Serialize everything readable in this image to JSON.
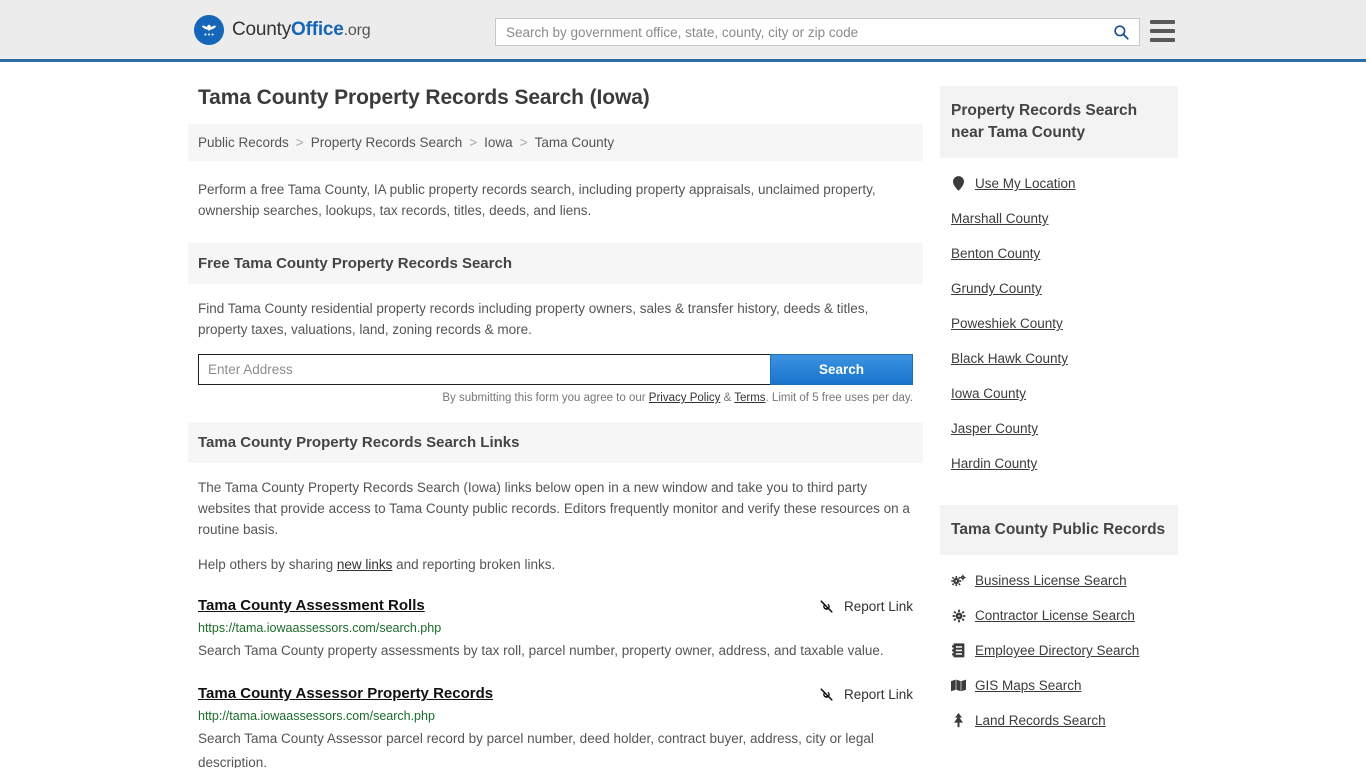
{
  "header": {
    "logo": {
      "icon": "eagle-seal-icon",
      "text_county": "County",
      "text_office": "Office",
      "text_org": ".org"
    },
    "search": {
      "placeholder": "Search by government office, state, county, city or zip code",
      "value": "",
      "icon": "search-icon"
    },
    "menu_icon": "hamburger-menu-icon",
    "accent_color": "#2e6da4",
    "background_color": "#ececec"
  },
  "main": {
    "title": "Tama County Property Records Search (Iowa)",
    "breadcrumb": [
      {
        "label": "Public Records"
      },
      {
        "label": "Property Records Search"
      },
      {
        "label": "Iowa"
      },
      {
        "label": "Tama County"
      }
    ],
    "breadcrumb_separator": ">",
    "lead": "Perform a free Tama County, IA public property records search, including property appraisals, unclaimed property, ownership searches, lookups, tax records, titles, deeds, and liens.",
    "free_search": {
      "heading": "Free Tama County Property Records Search",
      "description": "Find Tama County residential property records including property owners, sales & transfer history, deeds & titles, property taxes, valuations, land, zoning records & more.",
      "address_placeholder": "Enter Address",
      "address_value": "",
      "submit_label": "Search",
      "note_prefix": "By submitting this form you agree to our ",
      "note_privacy": "Privacy Policy",
      "note_amp": " & ",
      "note_terms": "Terms",
      "note_suffix": ". Limit of 5 free uses per day.",
      "button_color": "#1874cd"
    },
    "links_section": {
      "heading": "Tama County Property Records Search Links",
      "paragraph1": "The Tama County Property Records Search (Iowa) links below open in a new window and take you to third party websites that provide access to Tama County public records. Editors frequently monitor and verify these resources on a routine basis.",
      "paragraph2_prefix": "Help others by sharing ",
      "paragraph2_link": "new links",
      "paragraph2_suffix": " and reporting broken links."
    },
    "report_link_label": "Report Link",
    "report_link_icon": "broken-link-icon",
    "results": [
      {
        "title": "Tama County Assessment Rolls",
        "url": "https://tama.iowaassessors.com/search.php",
        "description": "Search Tama County property assessments by tax roll, parcel number, property owner, address, and taxable value."
      },
      {
        "title": "Tama County Assessor Property Records",
        "url": "http://tama.iowaassessors.com/search.php",
        "description": "Search Tama County Assessor parcel record by parcel number, deed holder, contract buyer, address, city or legal description."
      }
    ]
  },
  "sidebar": {
    "nearby": {
      "heading": "Property Records Search near Tama County",
      "items": [
        {
          "label": "Use My Location",
          "icon": "map-pin-icon"
        },
        {
          "label": "Marshall County",
          "icon": ""
        },
        {
          "label": "Benton County",
          "icon": ""
        },
        {
          "label": "Grundy County",
          "icon": ""
        },
        {
          "label": "Poweshiek County",
          "icon": ""
        },
        {
          "label": "Black Hawk County",
          "icon": ""
        },
        {
          "label": "Iowa County",
          "icon": ""
        },
        {
          "label": "Jasper County",
          "icon": ""
        },
        {
          "label": "Hardin County",
          "icon": ""
        }
      ]
    },
    "public_records": {
      "heading": "Tama County Public Records",
      "items": [
        {
          "label": "Business License Search",
          "icon": "cogs-icon"
        },
        {
          "label": "Contractor License Search",
          "icon": "cog-icon"
        },
        {
          "label": "Employee Directory Search",
          "icon": "address-book-icon"
        },
        {
          "label": "GIS Maps Search",
          "icon": "map-icon"
        },
        {
          "label": "Land Records Search",
          "icon": "tree-icon"
        }
      ]
    }
  }
}
